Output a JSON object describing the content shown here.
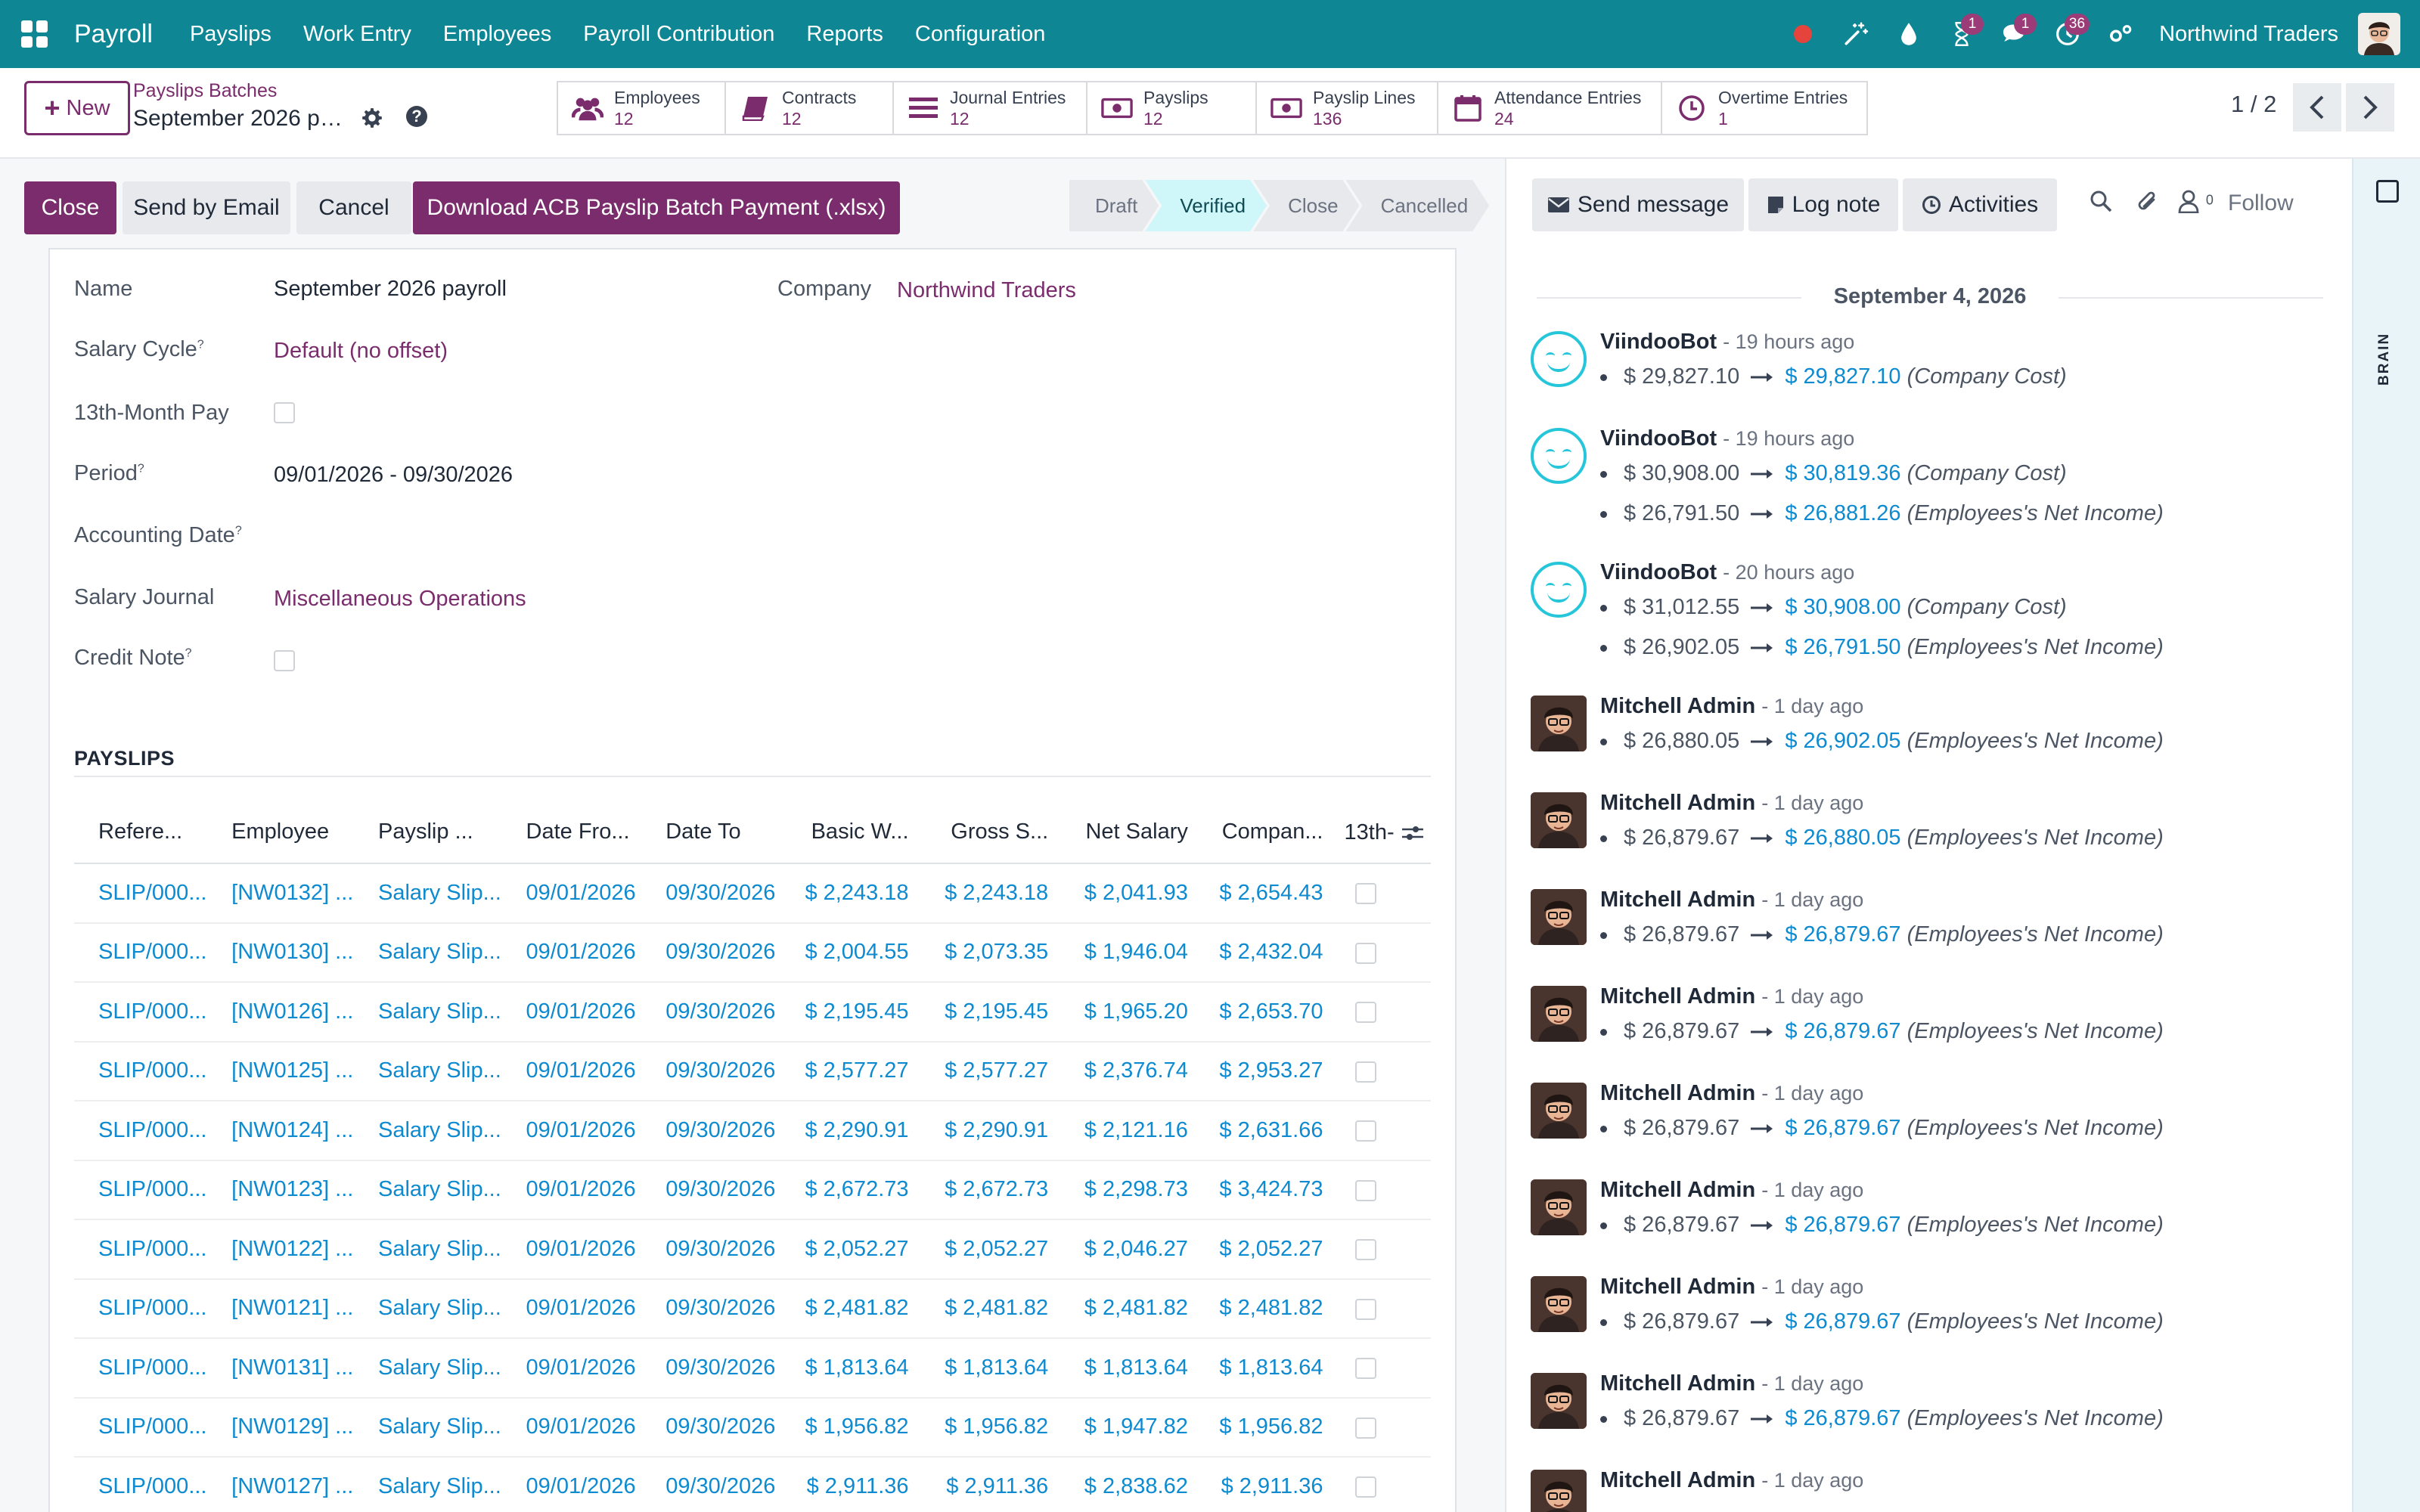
{
  "navbar": {
    "app_name": "Payroll",
    "menu": [
      "Payslips",
      "Work Entry",
      "Employees",
      "Payroll Contribution",
      "Reports",
      "Configuration"
    ],
    "badges": {
      "activities": "1",
      "messages": "1",
      "clock": "36"
    },
    "company": "Northwind Traders"
  },
  "control": {
    "new_label": "New",
    "breadcrumb": "Payslips Batches",
    "record_title": "September 2026 pay...",
    "smart_buttons": [
      {
        "label": "Employees",
        "value": "12",
        "icon": "users-icon"
      },
      {
        "label": "Contracts",
        "value": "12",
        "icon": "book-icon"
      },
      {
        "label": "Journal Entries",
        "value": "12",
        "icon": "list-icon"
      },
      {
        "label": "Payslips",
        "value": "12",
        "icon": "money-icon"
      },
      {
        "label": "Payslip Lines",
        "value": "136",
        "icon": "money-icon"
      },
      {
        "label": "Attendance Entries",
        "value": "24",
        "icon": "calendar-icon"
      },
      {
        "label": "Overtime Entries",
        "value": "1",
        "icon": "clock-icon"
      }
    ],
    "pager": "1 / 2"
  },
  "statusbar": {
    "buttons": [
      "Close",
      "Send by Email",
      "Cancel",
      "Download ACB Payslip Batch Payment (.xlsx)"
    ],
    "stages": [
      "Draft",
      "Verified",
      "Close",
      "Cancelled"
    ],
    "active_stage": "Verified"
  },
  "form": {
    "name_label": "Name",
    "name_value": "September 2026 payroll",
    "company_label": "Company",
    "company_value": "Northwind Traders",
    "salary_cycle_label": "Salary Cycle",
    "salary_cycle_value": "Default (no offset)",
    "thirteenth_label": "13th-Month Pay",
    "period_label": "Period",
    "period_value": "09/01/2026 - 09/30/2026",
    "accounting_date_label": "Accounting Date",
    "journal_label": "Salary Journal",
    "journal_value": "Miscellaneous Operations",
    "credit_note_label": "Credit Note",
    "help_mark": "?"
  },
  "payslips": {
    "section_title": "PAYSLIPS",
    "columns": [
      "Refere...",
      "Employee",
      "Payslip ...",
      "Date Fro...",
      "Date To",
      "Basic W...",
      "Gross S...",
      "Net Salary",
      "Compan...",
      "13th-"
    ],
    "rows": [
      [
        "SLIP/000...",
        "[NW0132] ...",
        "Salary Slip...",
        "09/01/2026",
        "09/30/2026",
        "$ 2,243.18",
        "$ 2,243.18",
        "$ 2,041.93",
        "$ 2,654.43"
      ],
      [
        "SLIP/000...",
        "[NW0130] ...",
        "Salary Slip...",
        "09/01/2026",
        "09/30/2026",
        "$ 2,004.55",
        "$ 2,073.35",
        "$ 1,946.04",
        "$ 2,432.04"
      ],
      [
        "SLIP/000...",
        "[NW0126] ...",
        "Salary Slip...",
        "09/01/2026",
        "09/30/2026",
        "$ 2,195.45",
        "$ 2,195.45",
        "$ 1,965.20",
        "$ 2,653.70"
      ],
      [
        "SLIP/000...",
        "[NW0125] ...",
        "Salary Slip...",
        "09/01/2026",
        "09/30/2026",
        "$ 2,577.27",
        "$ 2,577.27",
        "$ 2,376.74",
        "$ 2,953.27"
      ],
      [
        "SLIP/000...",
        "[NW0124] ...",
        "Salary Slip...",
        "09/01/2026",
        "09/30/2026",
        "$ 2,290.91",
        "$ 2,290.91",
        "$ 2,121.16",
        "$ 2,631.66"
      ],
      [
        "SLIP/000...",
        "[NW0123] ...",
        "Salary Slip...",
        "09/01/2026",
        "09/30/2026",
        "$ 2,672.73",
        "$ 2,672.73",
        "$ 2,298.73",
        "$ 3,424.73"
      ],
      [
        "SLIP/000...",
        "[NW0122] ...",
        "Salary Slip...",
        "09/01/2026",
        "09/30/2026",
        "$ 2,052.27",
        "$ 2,052.27",
        "$ 2,046.27",
        "$ 2,052.27"
      ],
      [
        "SLIP/000...",
        "[NW0121] ...",
        "Salary Slip...",
        "09/01/2026",
        "09/30/2026",
        "$ 2,481.82",
        "$ 2,481.82",
        "$ 2,481.82",
        "$ 2,481.82"
      ],
      [
        "SLIP/000...",
        "[NW0131] ...",
        "Salary Slip...",
        "09/01/2026",
        "09/30/2026",
        "$ 1,813.64",
        "$ 1,813.64",
        "$ 1,813.64",
        "$ 1,813.64"
      ],
      [
        "SLIP/000...",
        "[NW0129] ...",
        "Salary Slip...",
        "09/01/2026",
        "09/30/2026",
        "$ 1,956.82",
        "$ 1,956.82",
        "$ 1,947.82",
        "$ 1,956.82"
      ],
      [
        "SLIP/000...",
        "[NW0127] ...",
        "Salary Slip...",
        "09/01/2026",
        "09/30/2026",
        "$ 2,911.36",
        "$ 2,911.36",
        "$ 2,838.62",
        "$ 2,911.36"
      ]
    ]
  },
  "chatter": {
    "send_message": "Send message",
    "log_note": "Log note",
    "activities": "Activities",
    "followers_count": "0",
    "follow": "Follow",
    "date_separator": "September 4, 2026",
    "messages": [
      {
        "author": "ViindooBot",
        "time": "- 19 hours ago",
        "bot": true,
        "lines": [
          [
            "$ 29,827.10",
            "$ 29,827.10",
            "(Company Cost)"
          ]
        ]
      },
      {
        "author": "ViindooBot",
        "time": "- 19 hours ago",
        "bot": true,
        "lines": [
          [
            "$ 30,908.00",
            "$ 30,819.36",
            "(Company Cost)"
          ],
          [
            "$ 26,791.50",
            "$ 26,881.26",
            "(Employees's Net Income)"
          ]
        ]
      },
      {
        "author": "ViindooBot",
        "time": "- 20 hours ago",
        "bot": true,
        "lines": [
          [
            "$ 31,012.55",
            "$ 30,908.00",
            "(Company Cost)"
          ],
          [
            "$ 26,902.05",
            "$ 26,791.50",
            "(Employees's Net Income)"
          ]
        ]
      },
      {
        "author": "Mitchell Admin",
        "time": "- 1 day ago",
        "bot": false,
        "lines": [
          [
            "$ 26,880.05",
            "$ 26,902.05",
            "(Employees's Net Income)"
          ]
        ]
      },
      {
        "author": "Mitchell Admin",
        "time": "- 1 day ago",
        "bot": false,
        "lines": [
          [
            "$ 26,879.67",
            "$ 26,880.05",
            "(Employees's Net Income)"
          ]
        ]
      },
      {
        "author": "Mitchell Admin",
        "time": "- 1 day ago",
        "bot": false,
        "lines": [
          [
            "$ 26,879.67",
            "$ 26,879.67",
            "(Employees's Net Income)"
          ]
        ]
      },
      {
        "author": "Mitchell Admin",
        "time": "- 1 day ago",
        "bot": false,
        "lines": [
          [
            "$ 26,879.67",
            "$ 26,879.67",
            "(Employees's Net Income)"
          ]
        ]
      },
      {
        "author": "Mitchell Admin",
        "time": "- 1 day ago",
        "bot": false,
        "lines": [
          [
            "$ 26,879.67",
            "$ 26,879.67",
            "(Employees's Net Income)"
          ]
        ]
      },
      {
        "author": "Mitchell Admin",
        "time": "- 1 day ago",
        "bot": false,
        "lines": [
          [
            "$ 26,879.67",
            "$ 26,879.67",
            "(Employees's Net Income)"
          ]
        ]
      },
      {
        "author": "Mitchell Admin",
        "time": "- 1 day ago",
        "bot": false,
        "lines": [
          [
            "$ 26,879.67",
            "$ 26,879.67",
            "(Employees's Net Income)"
          ]
        ]
      },
      {
        "author": "Mitchell Admin",
        "time": "- 1 day ago",
        "bot": false,
        "lines": [
          [
            "$ 26,879.67",
            "$ 26,879.67",
            "(Employees's Net Income)"
          ]
        ]
      },
      {
        "author": "Mitchell Admin",
        "time": "- 1 day ago",
        "bot": false,
        "lines": []
      }
    ]
  },
  "rail": {
    "label": "BRAIN"
  },
  "colors": {
    "navbar": "#0f8694",
    "primary": "#7a2c6c",
    "link": "#0d8ad0",
    "active_stage": "#cff6f9",
    "bot_avatar": "#26c6da"
  }
}
